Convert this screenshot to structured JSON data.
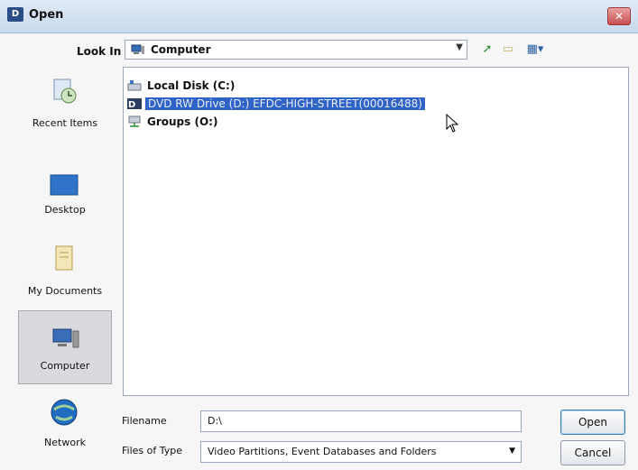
{
  "window": {
    "title": "Open",
    "icon_letter": "D"
  },
  "toolbar": {
    "look_in_label": "Look In",
    "look_in_value": "Computer",
    "up_icon": "up-folder-icon",
    "new_folder_icon": "new-folder-icon",
    "views_icon": "views-menu-icon"
  },
  "places": [
    {
      "label": "Recent Items",
      "icon": "recent-items-icon",
      "selected": false
    },
    {
      "label": "Desktop",
      "icon": "desktop-icon",
      "selected": false
    },
    {
      "label": "My Documents",
      "icon": "my-documents-icon",
      "selected": false
    },
    {
      "label": "Computer",
      "icon": "computer-icon",
      "selected": true
    },
    {
      "label": "Network",
      "icon": "network-icon",
      "selected": false
    }
  ],
  "files": [
    {
      "label": "Local Disk (C:)",
      "icon": "hard-drive-icon",
      "selected": false
    },
    {
      "label": "DVD RW Drive (D:) EFDC-HIGH-STREET(00016488)",
      "icon": "dvd-drive-icon",
      "selected": true
    },
    {
      "label": "Groups (O:)",
      "icon": "network-drive-icon",
      "selected": false
    }
  ],
  "bottom": {
    "filename_label": "Filename",
    "filename_value": "D:\\",
    "filetype_label": "Files of Type",
    "filetype_value": "Video Partitions, Event Databases and Folders",
    "open_label": "Open",
    "cancel_label": "Cancel"
  },
  "colors": {
    "selection": "#2f63c7",
    "titlebar": "#c9d9ee"
  }
}
